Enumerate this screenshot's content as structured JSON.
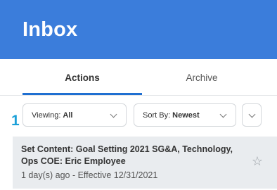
{
  "header": {
    "title": "Inbox"
  },
  "tabs": [
    {
      "label": "Actions",
      "active": true
    },
    {
      "label": "Archive",
      "active": false
    }
  ],
  "filters": {
    "step_number": "1",
    "viewing": {
      "label": "Viewing:",
      "value": "All"
    },
    "sort": {
      "label": "Sort By:",
      "value": "Newest"
    }
  },
  "inbox_items": [
    {
      "title": "Set Content: Goal Setting 2021 SG&A, Technology, Ops COE: Eric Employee",
      "meta": "1 day(s) ago - Effective 12/31/2021",
      "star_icon": "star-outline-icon"
    }
  ],
  "colors": {
    "header_bg": "#3b7ddb",
    "tab_indicator": "#1f6fd1",
    "step_number": "#1ba0d8",
    "item_bg": "#e9ecef"
  }
}
